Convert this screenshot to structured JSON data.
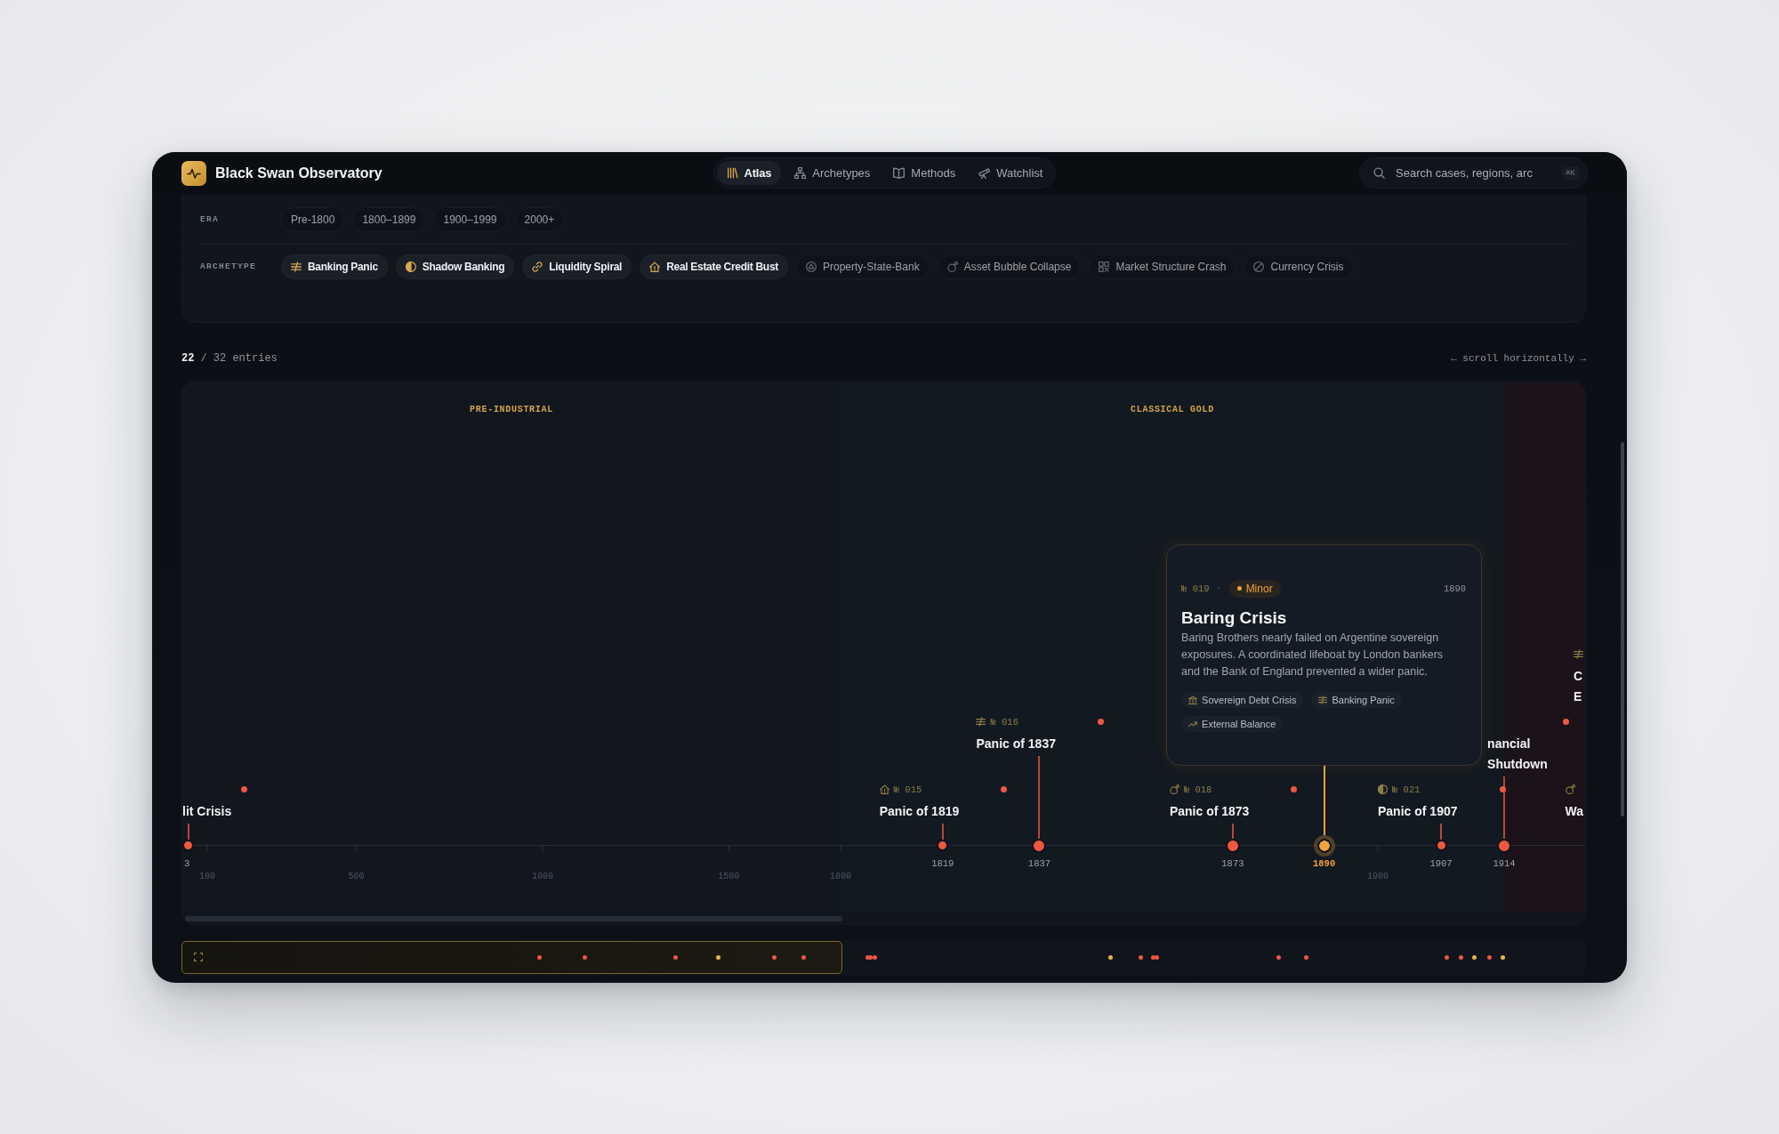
{
  "app": {
    "title": "Black Swan Observatory"
  },
  "nav": [
    {
      "label": "Atlas",
      "kind": "library",
      "selected": true
    },
    {
      "label": "Archetypes",
      "kind": "hierarchy",
      "selected": false
    },
    {
      "label": "Methods",
      "kind": "book",
      "selected": false
    },
    {
      "label": "Watchlist",
      "kind": "telescope",
      "selected": false
    }
  ],
  "search": {
    "placeholder": "Search cases, regions, arc",
    "shortcut": "⌘K"
  },
  "filters": [
    {
      "label": "ERA",
      "chips": [
        {
          "label": "Pre-1800",
          "selected": false
        },
        {
          "label": "1800–1899",
          "selected": false
        },
        {
          "label": "1900–1999",
          "selected": false
        },
        {
          "label": "2000+",
          "selected": false
        }
      ]
    },
    {
      "label": "ARCHETYPE",
      "chips": [
        {
          "label": "Banking Panic",
          "kind": "banking-panic",
          "selected": true
        },
        {
          "label": "Shadow Banking",
          "kind": "shadow-banking",
          "selected": true
        },
        {
          "label": "Liquidity Spiral",
          "kind": "liquidity-spiral",
          "selected": true
        },
        {
          "label": "Real Estate Credit Bust",
          "kind": "real-estate",
          "selected": true
        },
        {
          "label": "Property-State-Bank",
          "kind": "property-state",
          "selected": false
        },
        {
          "label": "Asset Bubble Collapse",
          "kind": "asset-bubble",
          "selected": false
        },
        {
          "label": "Market Structure Crash",
          "kind": "market-structure",
          "selected": false
        },
        {
          "label": "Currency Crisis",
          "kind": "currency",
          "selected": false
        }
      ]
    }
  ],
  "results": {
    "count": "22",
    "total": "/ 32 entries",
    "hint": "← scroll horizontally →"
  },
  "timeline": {
    "eras": [
      {
        "label": "PRE-INDUSTRIAL",
        "color": "#12161e"
      },
      {
        "label": "CLASSICAL GOLD",
        "color": "#131920"
      },
      {
        "color": "#1b1319"
      }
    ],
    "ticks": [
      "100",
      "500",
      "1000",
      "1500",
      "1800",
      "1900"
    ],
    "events": [
      {
        "year": "3",
        "title": [
          "lit Crisis"
        ],
        "color": "#ef5743",
        "major": false,
        "selected": false
      },
      {
        "year": "1819",
        "number": "№ 015",
        "kind": "real-estate",
        "title": [
          "Panic of 1819"
        ],
        "color": "#ef5743",
        "major": false,
        "selected": false
      },
      {
        "year": "1837",
        "number": "№ 016",
        "kind": "banking-panic",
        "title": [
          "Panic of 1837"
        ],
        "color": "#ef5743",
        "major": true,
        "selected": false
      },
      {
        "year": "1873",
        "number": "№ 018",
        "kind": "asset-bubble",
        "title": [
          "Panic of 1873"
        ],
        "color": "#ef5743",
        "major": true,
        "selected": false
      },
      {
        "year": "1890",
        "color": "#f0a33a",
        "major": false,
        "selected": true,
        "detail": {
          "number": "№ 019",
          "separator": "·",
          "severity": "Minor",
          "year": "1890",
          "title": "Baring Crisis",
          "description": "Baring Brothers nearly failed on Argentine sovereign exposures. A coordinated lifeboat by London bankers and the Bank of England prevented a wider panic.",
          "tags": [
            {
              "label": "Sovereign Debt Crisis",
              "kind": "sovereign-debt"
            },
            {
              "label": "Banking Panic",
              "kind": "banking-panic"
            },
            {
              "label": "External Balance",
              "kind": "external-balance"
            }
          ]
        }
      },
      {
        "year": "1907",
        "number": "№ 021",
        "kind": "shadow-banking",
        "title": [
          "Panic of 1907"
        ],
        "color": "#ef5743",
        "major": false,
        "selected": false
      },
      {
        "year": "1914",
        "title": [
          "nancial",
          "Shutdown"
        ],
        "color": "#ef5743",
        "major": true,
        "selected": false
      },
      {
        "kind": "asset-bubble",
        "title": [
          "Wa"
        ],
        "selected": false
      },
      {
        "kind": "banking-panic",
        "title": [
          "C",
          "E"
        ],
        "selected": false
      }
    ]
  },
  "minimap": {
    "dots": [
      {
        "color": "#ef5743"
      },
      {
        "color": "#ef5743"
      },
      {
        "color": "#ef5743"
      },
      {
        "color": "#e8b64a"
      },
      {
        "color": "#ef5743"
      },
      {
        "color": "#ef5743"
      },
      {
        "color": "#ef5743"
      },
      {
        "color": "#ef5743"
      },
      {
        "color": "#ef5743"
      },
      {
        "color": "#e8b64a"
      },
      {
        "color": "#ef5743"
      },
      {
        "color": "#ef5743"
      },
      {
        "color": "#ef5743"
      },
      {
        "color": "#ef5743"
      },
      {
        "color": "#ef5743"
      },
      {
        "color": "#ef5743"
      },
      {
        "color": "#ef5743"
      },
      {
        "color": "#e8b64a"
      },
      {
        "color": "#ef5743"
      },
      {
        "color": "#e8b64a"
      }
    ]
  }
}
